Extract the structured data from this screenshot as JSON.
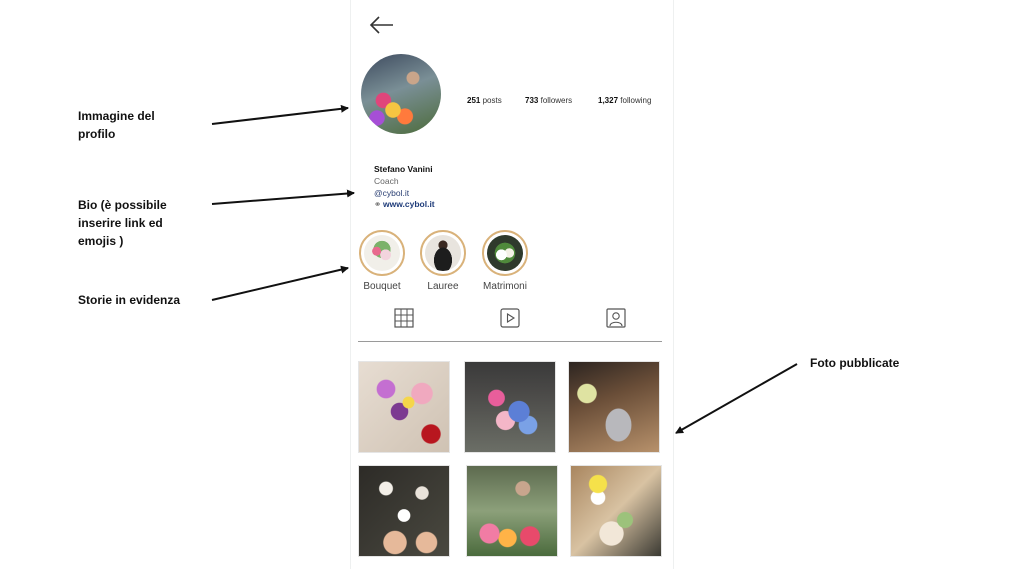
{
  "annotations": {
    "profile_image": [
      "Immagine del",
      "profilo"
    ],
    "bio": [
      "Bio (è possibile",
      "inserire link ed",
      "emojis )"
    ],
    "highlights": [
      "Storie in evidenza"
    ],
    "posts": [
      "Foto pubblicate"
    ]
  },
  "profile": {
    "stats": {
      "posts_count": "251",
      "posts_label": "posts",
      "followers_count": "733",
      "followers_label": "followers",
      "following_count": "1,327",
      "following_label": "following"
    },
    "bio": {
      "name": "Stefano Vanini",
      "role": "Coach",
      "handle": "@cybol.it",
      "link": "www.cybol.it"
    }
  },
  "highlights": [
    {
      "label": "Bouquet"
    },
    {
      "label": "Lauree"
    },
    {
      "label": "Matrimoni"
    }
  ],
  "tabs": [
    "grid-icon",
    "reels-icon",
    "tagged-icon"
  ],
  "colors": {
    "arrow": "#111111",
    "link": "#1f3c7a",
    "highlight_ring": "#d9b27a"
  }
}
